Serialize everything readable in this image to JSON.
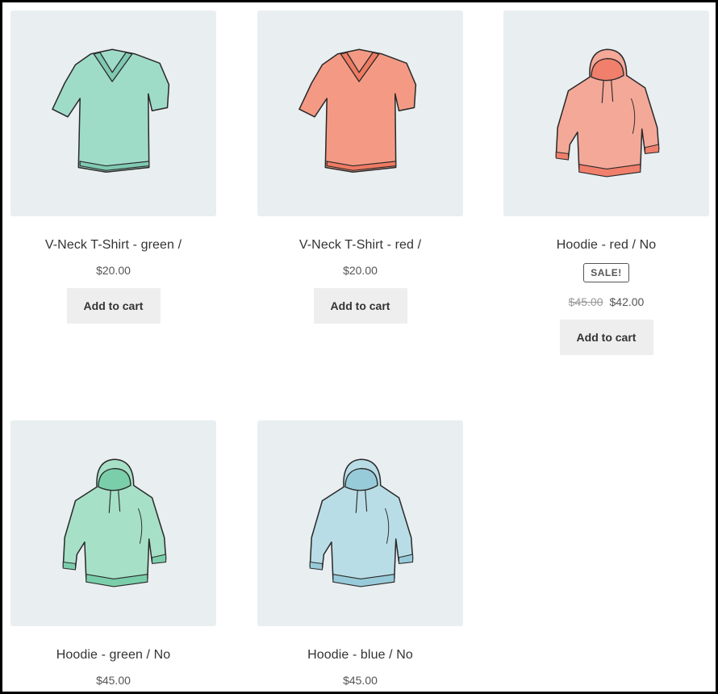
{
  "products": [
    {
      "title": "V-Neck T-Shirt - green /",
      "price": "$20.00",
      "button": "Add to cart",
      "image": "vneck-tshirt-illustration",
      "color": "#9fdcc8",
      "shade": "#7fc9b2"
    },
    {
      "title": "V-Neck T-Shirt - red /",
      "price": "$20.00",
      "button": "Add to cart",
      "image": "vneck-tshirt-illustration",
      "color": "#f49a84",
      "shade": "#ef7a62"
    },
    {
      "title": "Hoodie - red / No",
      "badge": "SALE!",
      "old_price": "$45.00",
      "price": "$42.00",
      "button": "Add to cart",
      "image": "hoodie-illustration",
      "color": "#f4a898",
      "shade": "#f07f6c"
    },
    {
      "title": "Hoodie - green / No",
      "price": "$45.00",
      "image": "hoodie-illustration",
      "color": "#a6e0c7",
      "shade": "#7acfaa"
    },
    {
      "title": "Hoodie - blue / No",
      "price": "$45.00",
      "image": "hoodie-illustration",
      "color": "#b9dde6",
      "shade": "#98cbd9"
    }
  ]
}
